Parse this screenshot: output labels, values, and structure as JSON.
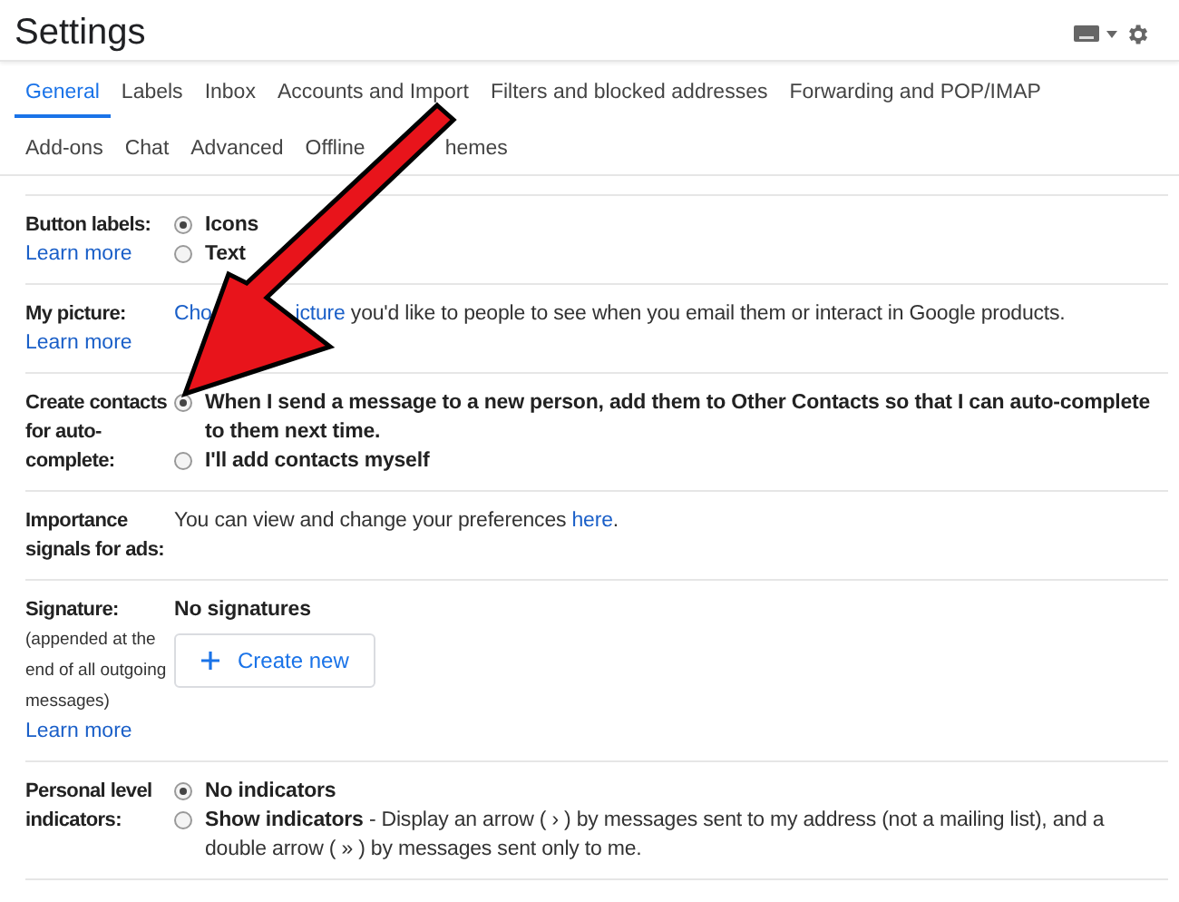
{
  "header": {
    "title": "Settings"
  },
  "tab_rows": [
    [
      {
        "label": "General",
        "selected": true
      },
      {
        "label": "Labels",
        "selected": false
      },
      {
        "label": "Inbox",
        "selected": false
      },
      {
        "label": "Accounts and Import",
        "selected": false
      },
      {
        "label": "Filters and blocked addresses",
        "selected": false
      },
      {
        "label": "Forwarding and POP/IMAP",
        "selected": false
      }
    ],
    [
      {
        "label": "Add-ons",
        "selected": false
      },
      {
        "label": "Chat",
        "selected": false
      },
      {
        "label": "Advanced",
        "selected": false
      },
      {
        "label": "Offline",
        "selected": false
      },
      {
        "label": "hemes",
        "selected": false
      }
    ]
  ],
  "settings": [
    {
      "kind": "radio",
      "label": "Button labels:",
      "learn_more": "Learn more",
      "options": [
        {
          "label": "Icons",
          "selected": true
        },
        {
          "label": "Text",
          "selected": false
        }
      ]
    },
    {
      "kind": "picture",
      "label": "My picture:",
      "learn_more": "Learn more",
      "link_parts": [
        "Cho",
        "icture"
      ],
      "text": "you'd like to people to see when you email them or interact in Google products."
    },
    {
      "kind": "radio",
      "label": "Create contacts for auto-complete:",
      "options": [
        {
          "label": "When I send a message to a new person, add them to Other Contacts so that I can auto-complete to them next time.",
          "selected": true
        },
        {
          "label": "I'll add contacts myself",
          "selected": false
        }
      ]
    },
    {
      "kind": "text",
      "label": "Importance signals for ads:",
      "text": "You can view and change your preferences ",
      "link": "here",
      "after": "."
    },
    {
      "kind": "signature",
      "label": "Signature:",
      "note": "(appended at the end of all outgoing messages)",
      "learn_more": "Learn more",
      "status": "No signatures",
      "button": "Create new"
    },
    {
      "kind": "radio",
      "label": "Personal level indicators:",
      "options": [
        {
          "label": "No indicators",
          "selected": true
        },
        {
          "label": "Show indicators",
          "description": "- Display an arrow ( › ) by messages sent to my address (not a mailing list), and a double arrow ( » ) by messages sent only to me.",
          "selected": false
        }
      ]
    }
  ]
}
